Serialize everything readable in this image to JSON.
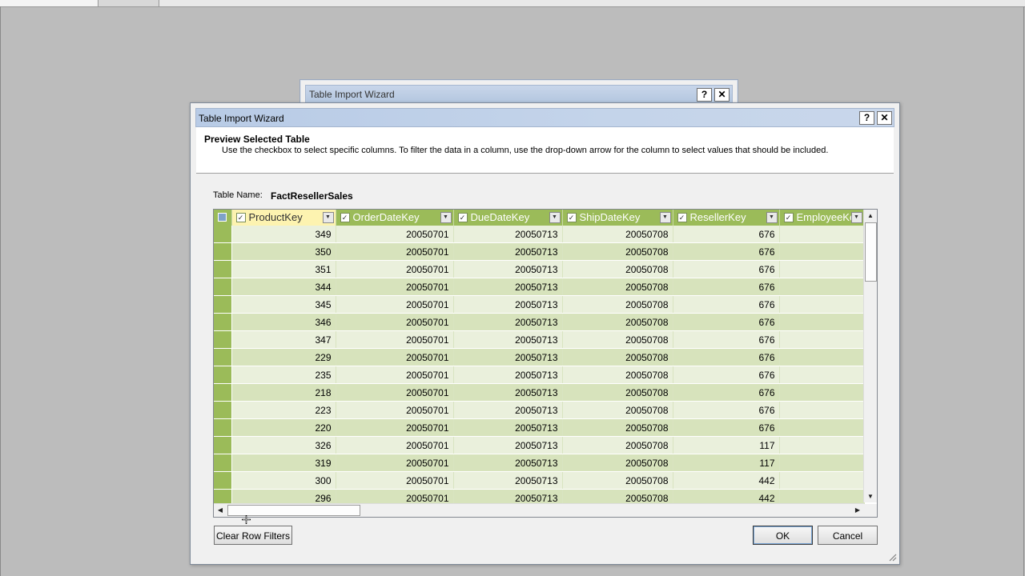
{
  "background_window": {
    "title": "Table Import Wizard",
    "help_button": "?",
    "close_button": "✕"
  },
  "dialog": {
    "title": "Table Import Wizard",
    "help_button": "?",
    "close_button": "✕",
    "heading": "Preview Selected Table",
    "description": "Use the checkbox to select specific columns. To filter the data in a column, use the drop-down arrow  for the column to select values that should be included.",
    "table_name_label": "Table Name:",
    "table_name_value": "FactResellerSales"
  },
  "grid": {
    "columns": [
      {
        "label": "ProductKey",
        "checked": true,
        "selected": true
      },
      {
        "label": "OrderDateKey",
        "checked": true,
        "selected": false
      },
      {
        "label": "DueDateKey",
        "checked": true,
        "selected": false
      },
      {
        "label": "ShipDateKey",
        "checked": true,
        "selected": false
      },
      {
        "label": "ResellerKey",
        "checked": true,
        "selected": false
      },
      {
        "label": "EmployeeKey",
        "checked": true,
        "selected": false
      }
    ],
    "rows": [
      [
        "349",
        "20050701",
        "20050713",
        "20050708",
        "676",
        ""
      ],
      [
        "350",
        "20050701",
        "20050713",
        "20050708",
        "676",
        ""
      ],
      [
        "351",
        "20050701",
        "20050713",
        "20050708",
        "676",
        ""
      ],
      [
        "344",
        "20050701",
        "20050713",
        "20050708",
        "676",
        ""
      ],
      [
        "345",
        "20050701",
        "20050713",
        "20050708",
        "676",
        ""
      ],
      [
        "346",
        "20050701",
        "20050713",
        "20050708",
        "676",
        ""
      ],
      [
        "347",
        "20050701",
        "20050713",
        "20050708",
        "676",
        ""
      ],
      [
        "229",
        "20050701",
        "20050713",
        "20050708",
        "676",
        ""
      ],
      [
        "235",
        "20050701",
        "20050713",
        "20050708",
        "676",
        ""
      ],
      [
        "218",
        "20050701",
        "20050713",
        "20050708",
        "676",
        ""
      ],
      [
        "223",
        "20050701",
        "20050713",
        "20050708",
        "676",
        ""
      ],
      [
        "220",
        "20050701",
        "20050713",
        "20050708",
        "676",
        ""
      ],
      [
        "326",
        "20050701",
        "20050713",
        "20050708",
        "117",
        ""
      ],
      [
        "319",
        "20050701",
        "20050713",
        "20050708",
        "117",
        ""
      ],
      [
        "300",
        "20050701",
        "20050713",
        "20050708",
        "442",
        ""
      ],
      [
        "296",
        "20050701",
        "20050713",
        "20050708",
        "442",
        ""
      ]
    ]
  },
  "buttons": {
    "clear_filters": "Clear Row Filters",
    "ok": "OK",
    "cancel": "Cancel"
  },
  "colors": {
    "header_green": "#9bbb59",
    "selected_header": "#fdf3b0",
    "row_odd": "#eaf0dc",
    "row_even": "#d7e3bc"
  }
}
